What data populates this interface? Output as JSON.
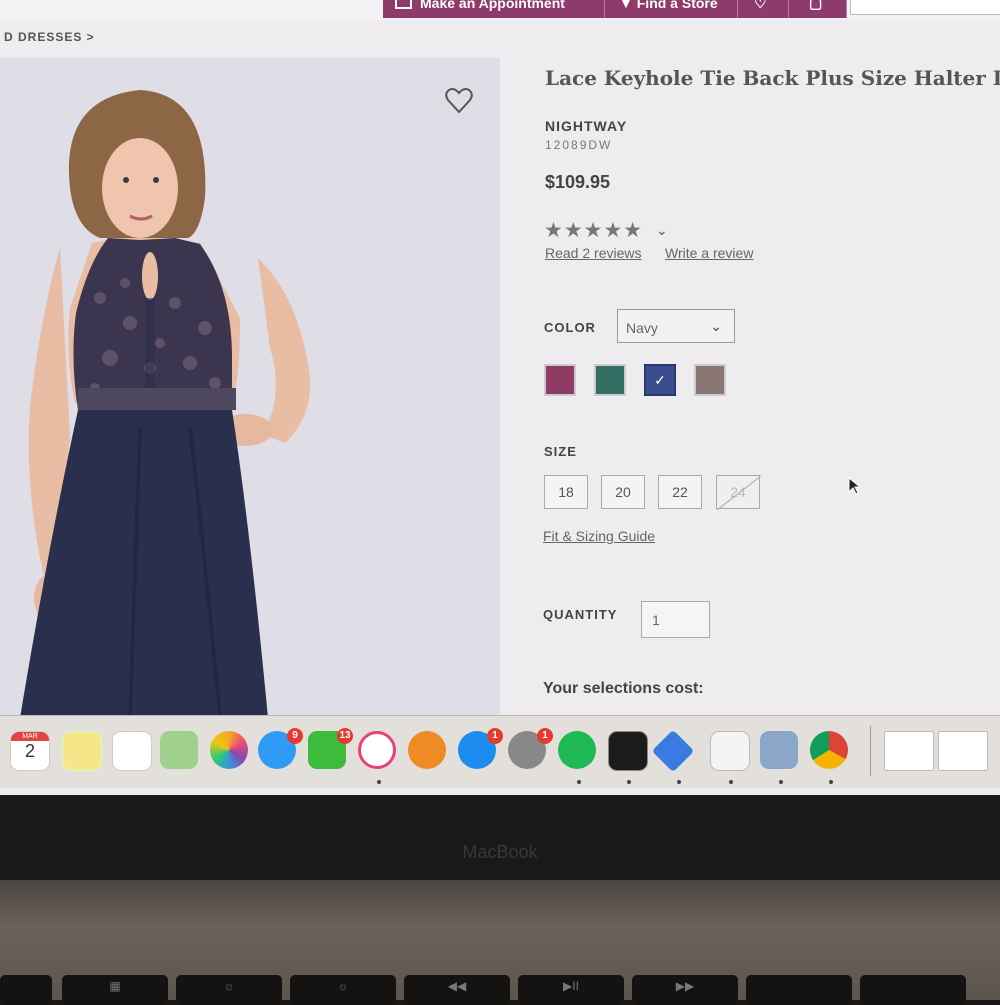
{
  "header": {
    "appointment_label": "Make an Appointment",
    "find_store_label": "Find a Store"
  },
  "breadcrumb": {
    "text": "D DRESSES >"
  },
  "product": {
    "title": "Lace Keyhole Tie Back Plus Size Halter Dre",
    "brand": "NIGHTWAY",
    "sku": "12089DW",
    "price": "$109.95",
    "stars": "★★★★★",
    "rating": 5,
    "read_reviews": "Read 2 reviews",
    "write_review": "Write a review"
  },
  "color": {
    "label": "COLOR",
    "selected": "Navy",
    "swatches": [
      {
        "name": "berry",
        "hex": "#8e3a65",
        "selected": false
      },
      {
        "name": "teal",
        "hex": "#336e63",
        "selected": false
      },
      {
        "name": "navy",
        "hex": "#3a4d8c",
        "selected": true
      },
      {
        "name": "taupe",
        "hex": "#8a7675",
        "selected": false
      }
    ]
  },
  "size": {
    "label": "SIZE",
    "options": [
      {
        "value": "18",
        "available": true
      },
      {
        "value": "20",
        "available": true
      },
      {
        "value": "22",
        "available": true
      },
      {
        "value": "24",
        "available": false
      }
    ],
    "guide_link": "Fit & Sizing Guide"
  },
  "quantity": {
    "label": "QUANTITY",
    "value": "1"
  },
  "cost_label": "Your selections cost:",
  "dock": {
    "calendar_month": "MAR",
    "calendar_day": "2",
    "badges": {
      "messages": "9",
      "facetime": "13",
      "appstore": "1",
      "settings": "1"
    }
  },
  "laptop": {
    "brand": "MacBook"
  },
  "colors": {
    "accent": "#8e3a6a",
    "dress": "#2b2f4e",
    "lace": "#3b3550"
  }
}
